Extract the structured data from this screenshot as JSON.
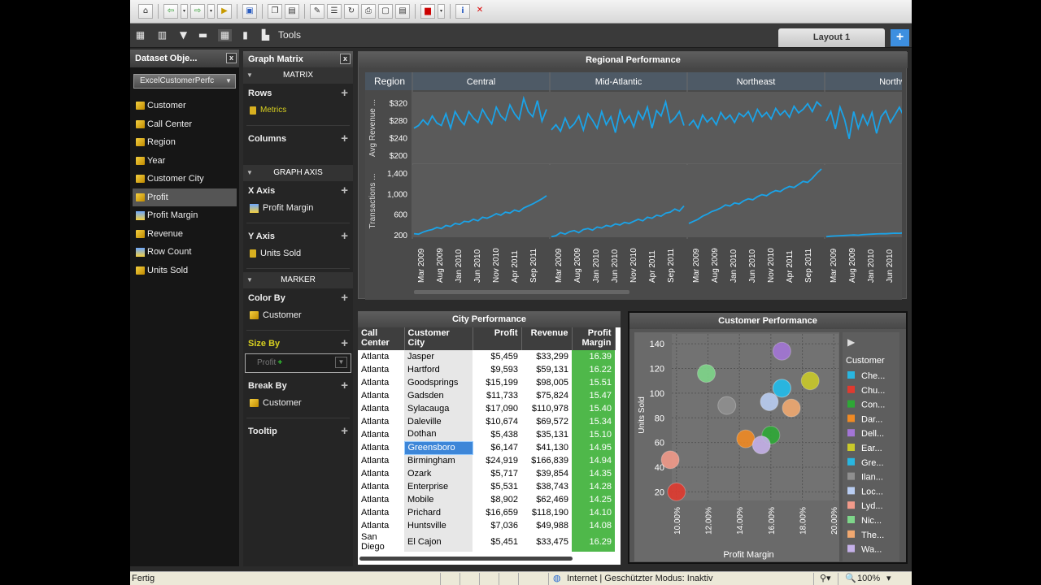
{
  "toolbar": {
    "icons": [
      "home-icon",
      "back-icon",
      "forward-icon",
      "open-icon",
      "save-icon",
      "copy-icon",
      "export-icon",
      "new-icon",
      "properties-icon",
      "refresh-icon",
      "print-icon",
      "page-icon",
      "document-icon",
      "pdf-icon",
      "info-icon",
      "close-icon"
    ]
  },
  "toolbar2": {
    "tools_label": "Tools",
    "layout_tab": "Layout 1",
    "add_tab": "+"
  },
  "dataset": {
    "title": "Dataset Obje...",
    "close": "x",
    "source": "ExcelCustomerPerfc",
    "items": [
      {
        "label": "Customer",
        "kind": "attribute"
      },
      {
        "label": "Call Center",
        "kind": "attribute"
      },
      {
        "label": "Region",
        "kind": "attribute"
      },
      {
        "label": "Year",
        "kind": "attribute"
      },
      {
        "label": "Customer City",
        "kind": "attribute"
      },
      {
        "label": "Profit",
        "kind": "attribute"
      },
      {
        "label": "Profit Margin",
        "kind": "metric"
      },
      {
        "label": "Revenue",
        "kind": "attribute"
      },
      {
        "label": "Row Count",
        "kind": "metric"
      },
      {
        "label": "Units Sold",
        "kind": "attribute"
      }
    ]
  },
  "graph_matrix": {
    "title": "Graph Matrix",
    "close": "x",
    "matrix_label": "MATRIX",
    "rows_label": "Rows",
    "rows_item": "Metrics",
    "columns_label": "Columns",
    "graph_axis_label": "GRAPH AXIS",
    "x_axis_label": "X Axis",
    "x_axis_item": "Profit Margin",
    "y_axis_label": "Y Axis",
    "y_axis_item": "Units Sold",
    "marker_label": "MARKER",
    "color_by_label": "Color By",
    "color_by_item": "Customer",
    "size_by_label": "Size By",
    "size_by_item": "Profit",
    "break_by_label": "Break By",
    "break_by_item": "Customer",
    "tooltip_label": "Tooltip"
  },
  "regional": {
    "title": "Regional Performance",
    "region_label": "Region",
    "line_color": "#1aa3e8"
  },
  "city": {
    "title": "City Performance",
    "headers": [
      "Call Center",
      "Customer City",
      "Profit",
      "Revenue",
      "Profit Margin"
    ],
    "rows": [
      [
        "Atlanta",
        "Jasper",
        "$5,459",
        "$33,299",
        "16.39"
      ],
      [
        "Atlanta",
        "Hartford",
        "$9,593",
        "$59,131",
        "16.22"
      ],
      [
        "Atlanta",
        "Goodsprings",
        "$15,199",
        "$98,005",
        "15.51"
      ],
      [
        "Atlanta",
        "Gadsden",
        "$11,733",
        "$75,824",
        "15.47"
      ],
      [
        "Atlanta",
        "Sylacauga",
        "$17,090",
        "$110,978",
        "15.40"
      ],
      [
        "Atlanta",
        "Daleville",
        "$10,674",
        "$69,572",
        "15.34"
      ],
      [
        "Atlanta",
        "Dothan",
        "$5,438",
        "$35,131",
        "15.10"
      ],
      [
        "Atlanta",
        "Greensboro",
        "$6,147",
        "$41,130",
        "14.95"
      ],
      [
        "Atlanta",
        "Birmingham",
        "$24,919",
        "$166,839",
        "14.94"
      ],
      [
        "Atlanta",
        "Ozark",
        "$5,717",
        "$39,854",
        "14.35"
      ],
      [
        "Atlanta",
        "Enterprise",
        "$5,531",
        "$38,743",
        "14.28"
      ],
      [
        "Atlanta",
        "Mobile",
        "$8,902",
        "$62,469",
        "14.25"
      ],
      [
        "Atlanta",
        "Prichard",
        "$16,659",
        "$118,190",
        "14.10"
      ],
      [
        "Atlanta",
        "Huntsville",
        "$7,036",
        "$49,988",
        "14.08"
      ],
      [
        "San Diego",
        "El Cajon",
        "$5,451",
        "$33,475",
        "16.29"
      ]
    ]
  },
  "customer_perf": {
    "title": "Customer Performance",
    "legend_title": "Customer"
  },
  "chart_data": [
    {
      "type": "line",
      "title": "Regional Performance",
      "columns": [
        "Central",
        "Mid-Atlantic",
        "Northeast",
        "Northw"
      ],
      "x": [
        "Mar 2009",
        "Aug 2009",
        "Jan 2010",
        "Jun 2010",
        "Nov 2010",
        "Apr 2011",
        "Sep 2011"
      ],
      "rows": [
        {
          "ylabel": "Avg Revenue ...",
          "yticks": [
            "$320",
            "$280",
            "$240",
            "$200"
          ],
          "ylim": [
            180,
            345
          ],
          "series": [
            [
              262,
              268,
              281,
              270,
              290,
              274,
              268,
              295,
              262,
              300,
              282,
              270,
              300,
              285,
              275,
              305,
              287,
              272,
              310,
              290,
              280,
              315,
              295,
              282,
              330,
              300,
              288,
              325,
              278,
              305
            ],
            [
              258,
              270,
              255,
              285,
              262,
              272,
              290,
              258,
              295,
              280,
              262,
              300,
              270,
              288,
              252,
              302,
              275,
              290,
              265,
              300,
              282,
              310,
              262,
              302,
              290,
              322,
              275,
              285,
              300,
              268
            ],
            [
              268,
              280,
              262,
              292,
              276,
              286,
              270,
              298,
              282,
              292,
              275,
              296,
              288,
              300,
              278,
              305,
              288,
              298,
              283,
              307,
              292,
              302,
              287,
              312,
              297,
              305,
              318,
              300,
              322,
              312
            ],
            [
              278,
              300,
              260,
              310,
              282,
              238,
              300,
              262,
              292,
              270,
              298,
              250,
              288,
              302,
              275,
              292,
              310,
              288,
              298
            ]
          ]
        },
        {
          "ylabel": "Transactions ...",
          "yticks": [
            "1,400",
            "1,000",
            "600",
            "200"
          ],
          "ylim": [
            150,
            1560
          ],
          "series": [
            [
              220,
              210,
              250,
              280,
              300,
              340,
              320,
              380,
              360,
              420,
              400,
              460,
              450,
              500,
              470,
              540,
              520,
              560,
              610,
              580,
              640,
              620,
              680,
              650,
              720,
              760,
              800,
              850,
              900,
              960
            ],
            [
              160,
              180,
              240,
              210,
              260,
              280,
              240,
              300,
              320,
              290,
              350,
              330,
              380,
              360,
              410,
              390,
              440,
              420,
              460,
              500,
              470,
              540,
              520,
              580,
              560,
              620,
              640,
              700,
              660,
              760
            ],
            [
              420,
              460,
              500,
              560,
              600,
              650,
              680,
              720,
              780,
              760,
              820,
              800,
              860,
              900,
              880,
              940,
              980,
              960,
              1020,
              1060,
              1040,
              1100,
              1140,
              1120,
              1180,
              1240,
              1220,
              1300,
              1400,
              1480
            ],
            [
              160,
              170,
              175,
              180,
              185,
              190,
              195,
              190,
              200,
              205,
              210,
              215,
              220,
              218,
              225,
              230,
              228,
              235,
              240
            ]
          ]
        }
      ]
    },
    {
      "type": "scatter",
      "title": "Customer Performance",
      "xlabel": "Profit Margin",
      "ylabel": "Units Sold",
      "xticks": [
        "10.00%",
        "12.00%",
        "14.00%",
        "16.00%",
        "18.00%",
        "20.00%"
      ],
      "yticks": [
        "140",
        "120",
        "100",
        "80",
        "60",
        "40",
        "20"
      ],
      "xlim": [
        9.7,
        20.3
      ],
      "ylim": [
        13,
        148
      ],
      "points": [
        {
          "name": "Che...",
          "x": 16.7,
          "y": 104,
          "color": "#29b6e0"
        },
        {
          "name": "Chu...",
          "x": 10.0,
          "y": 20,
          "color": "#e03a2f"
        },
        {
          "name": "Con...",
          "x": 16.0,
          "y": 66,
          "color": "#2ea836"
        },
        {
          "name": "Dar...",
          "x": 14.4,
          "y": 63,
          "color": "#f08a24"
        },
        {
          "name": "Dell...",
          "x": 16.7,
          "y": 134,
          "color": "#a375d6"
        },
        {
          "name": "Ear...",
          "x": 18.5,
          "y": 110,
          "color": "#c9c92a"
        },
        {
          "name": "Gre...",
          "x": 16.7,
          "y": 104,
          "color": "#29b6e0"
        },
        {
          "name": "Ilan...",
          "x": 13.2,
          "y": 90,
          "color": "#8f8f8f"
        },
        {
          "name": "Loc...",
          "x": 15.9,
          "y": 93,
          "color": "#b9cdf2"
        },
        {
          "name": "Lyd...",
          "x": 9.6,
          "y": 46,
          "color": "#f19a8a"
        },
        {
          "name": "Nic...",
          "x": 11.9,
          "y": 116,
          "color": "#7ed68a"
        },
        {
          "name": "The...",
          "x": 17.3,
          "y": 88,
          "color": "#f0a870"
        },
        {
          "name": "Wa...",
          "x": 15.4,
          "y": 58,
          "color": "#c4b0e8"
        }
      ]
    }
  ],
  "statusbar": {
    "left": "Fertig",
    "zone": "Internet | Geschützter Modus: Inaktiv",
    "zoom": "100%"
  }
}
